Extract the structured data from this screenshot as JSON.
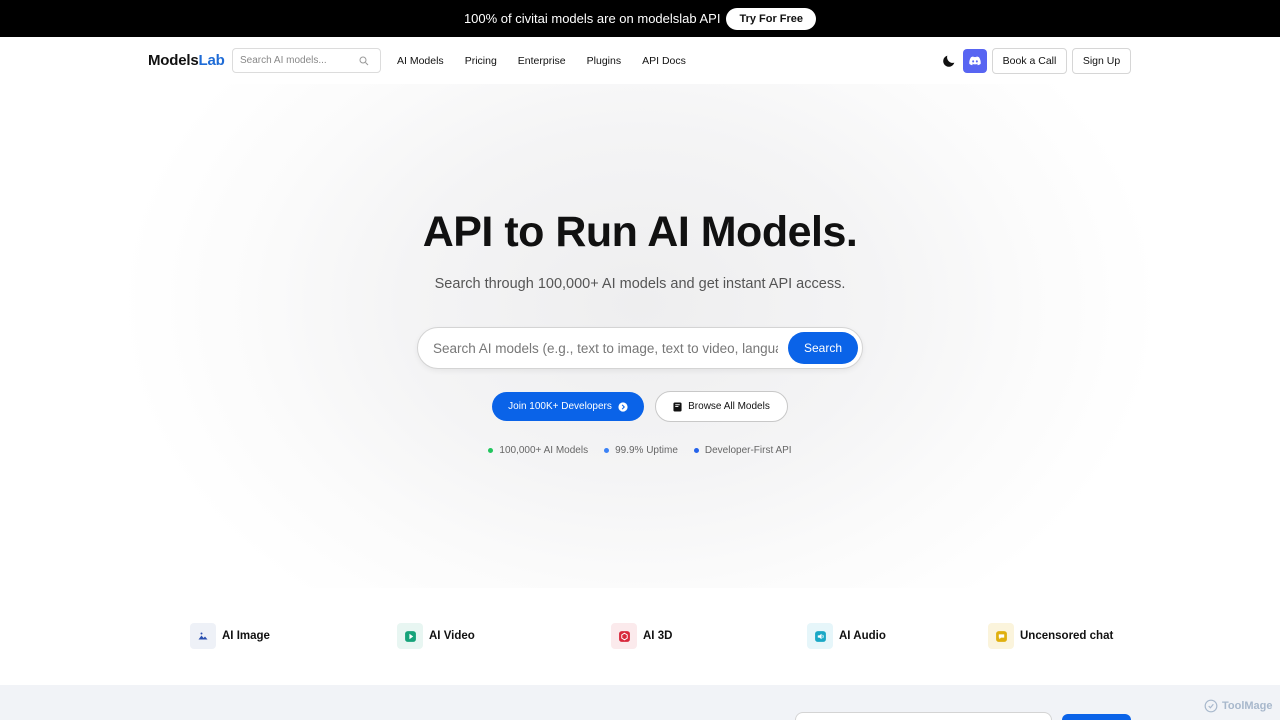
{
  "banner": {
    "text": "100% of civitai models are on modelslab API",
    "cta": "Try For Free"
  },
  "nav": {
    "logo_part1": "Models",
    "logo_part2": "Lab",
    "search_placeholder": "Search AI models...",
    "links": [
      "AI Models",
      "Pricing",
      "Enterprise",
      "Plugins",
      "API Docs"
    ],
    "book_call": "Book a Call",
    "sign_up": "Sign Up"
  },
  "hero": {
    "title": "API to Run AI Models.",
    "subtitle": "Search through 100,000+ AI models and get instant API access.",
    "search_placeholder": "Search AI models (e.g., text to image, text to video, language)",
    "search_button": "Search",
    "join_button": "Join 100K+ Developers",
    "browse_button": "Browse All Models",
    "stats": [
      {
        "label": "100,000+ AI Models",
        "color": "#22c55e"
      },
      {
        "label": "99.9% Uptime",
        "color": "#3b82f6"
      },
      {
        "label": "Developer-First API",
        "color": "#2563eb"
      }
    ]
  },
  "categories": [
    {
      "label": "AI Image",
      "icon": "image-icon",
      "bg": "#eef1f7",
      "fg": "#2a4fb0"
    },
    {
      "label": "AI Video",
      "icon": "video-icon",
      "bg": "#e8f6f2",
      "fg": "#16a37a"
    },
    {
      "label": "AI 3D",
      "icon": "cube-icon",
      "bg": "#fbeaec",
      "fg": "#d8283c"
    },
    {
      "label": "AI Audio",
      "icon": "audio-icon",
      "bg": "#e6f6fa",
      "fg": "#1aa8c6"
    },
    {
      "label": "Uncensored chat",
      "icon": "chat-icon",
      "bg": "#fbf4dc",
      "fg": "#e0b00e"
    }
  ],
  "watermark": "ToolMage",
  "colors": {
    "accent": "#0a63e8",
    "discord": "#5865f2",
    "logo_accent": "#1e6bd6"
  }
}
